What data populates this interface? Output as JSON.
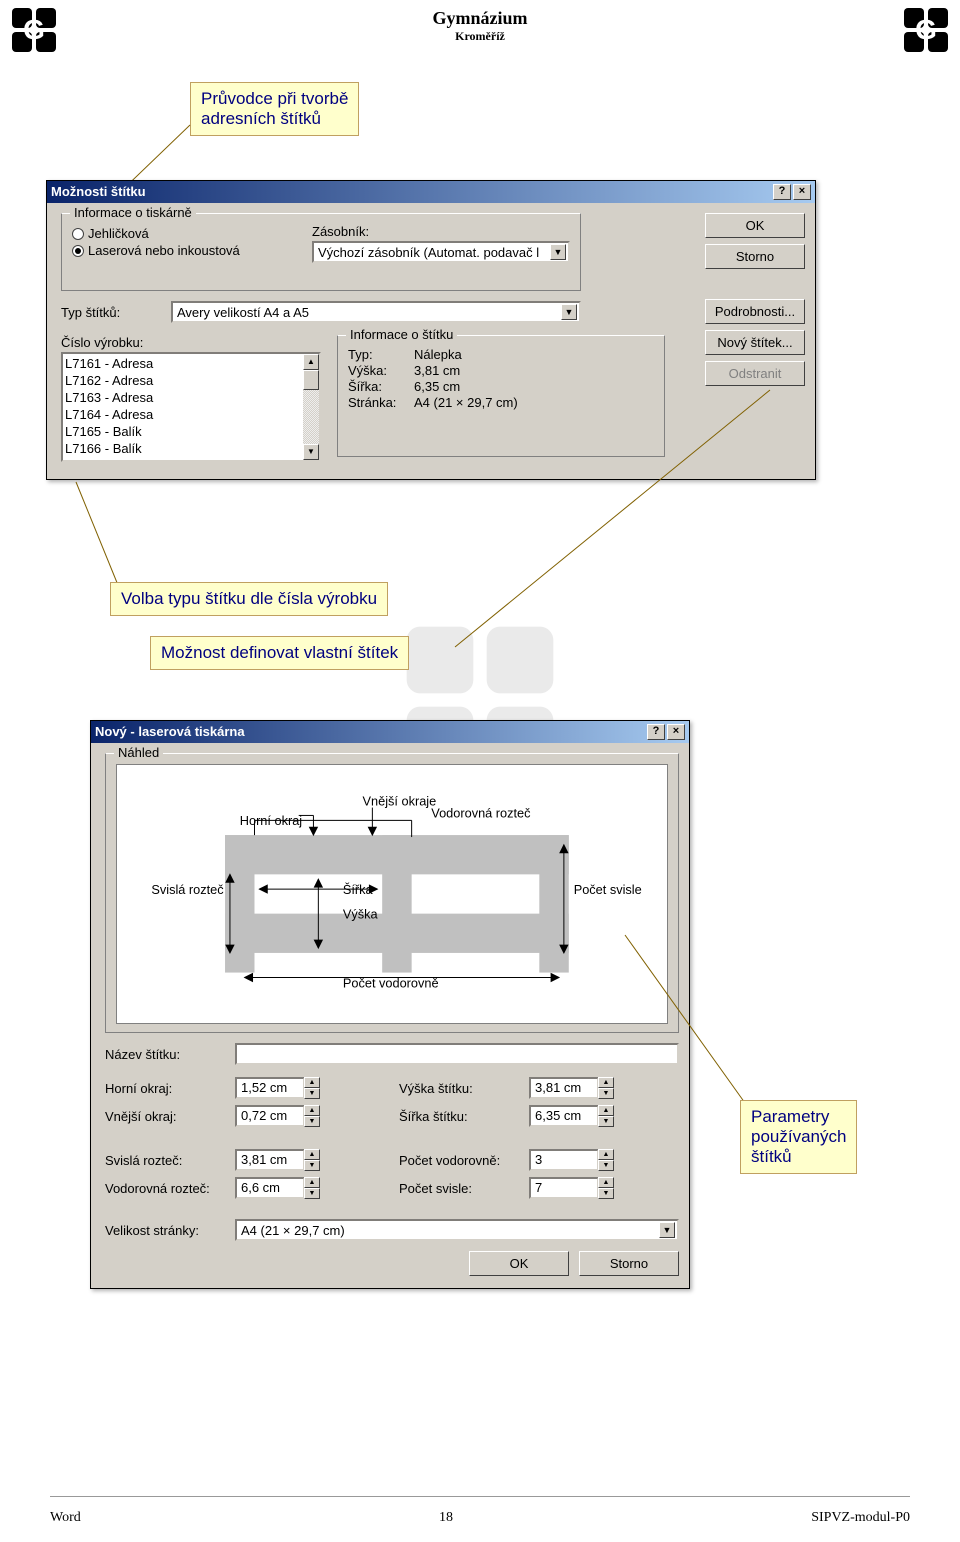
{
  "header": {
    "title": "Gymnázium",
    "subtitle": "Kroměříž"
  },
  "callouts": {
    "wizard": "Průvodce při tvorbě\nadresních štítků",
    "product_choice": "Volba typu štítku dle čísla výrobku",
    "custom_label": "Možnost definovat vlastní štítek",
    "params": "Parametry\npoužívaných\nštítků"
  },
  "dialog1": {
    "title": "Možnosti štítku",
    "help": "?",
    "close": "×",
    "group_printer_legend": "Informace o tiskárně",
    "radio_dot": "Jehličková",
    "radio_laser": "Laserová nebo inkoustová",
    "tray_label": "Zásobník:",
    "tray_value": "Výchozí zásobník (Automat. podavač l",
    "type_label": "Typ štítků:",
    "type_value": "Avery velikostí A4 a A5",
    "product_label": "Číslo výrobku:",
    "products": [
      "L7161 - Adresa",
      "L7162 - Adresa",
      "L7163 - Adresa",
      "L7164 - Adresa",
      "L7165 - Balík",
      "L7166 - Balík"
    ],
    "group_info_legend": "Informace o štítku",
    "info_type_k": "Typ:",
    "info_type_v": "Nálepka",
    "info_h_k": "Výška:",
    "info_h_v": "3,81 cm",
    "info_w_k": "Šířka:",
    "info_w_v": "6,35 cm",
    "info_p_k": "Stránka:",
    "info_p_v": "A4 (21 × 29,7 cm)",
    "btn_ok": "OK",
    "btn_cancel": "Storno",
    "btn_details": "Podrobnosti...",
    "btn_new": "Nový štítek...",
    "btn_delete": "Odstranit"
  },
  "dialog2": {
    "title": "Nový - laserová tiskárna",
    "help": "?",
    "close": "×",
    "preview_legend": "Náhled",
    "preview_labels": {
      "horni": "Horní okraj",
      "vnejsi": "Vnější okraje",
      "vodoroztec": "Vodorovná rozteč",
      "svisla": "Svislá rozteč",
      "sirka": "Šířka",
      "vyska": "Výška",
      "svisle": "Počet svisle",
      "vodorovne": "Počet vodorovně"
    },
    "name_label": "Název štítku:",
    "name_value": "",
    "horni_label": "Horní okraj:",
    "horni_value": "1,52 cm",
    "vnejsi_label": "Vnější okraj:",
    "vnejsi_value": "0,72 cm",
    "svisla_label": "Svislá rozteč:",
    "svisla_value": "3,81 cm",
    "vodor_label": "Vodorovná rozteč:",
    "vodor_value": "6,6 cm",
    "vyska_label": "Výška štítku:",
    "vyska_value": "3,81 cm",
    "sirka_label": "Šířka štítku:",
    "sirka_value": "6,35 cm",
    "pocv_label": "Počet vodorovně:",
    "pocv_value": "3",
    "pocs_label": "Počet svisle:",
    "pocs_value": "7",
    "page_label": "Velikost stránky:",
    "page_value": "A4 (21 × 29,7 cm)",
    "btn_ok": "OK",
    "btn_cancel": "Storno"
  },
  "footer": {
    "left": "Word",
    "center": "18",
    "right": "SIPVZ-modul-P0"
  }
}
